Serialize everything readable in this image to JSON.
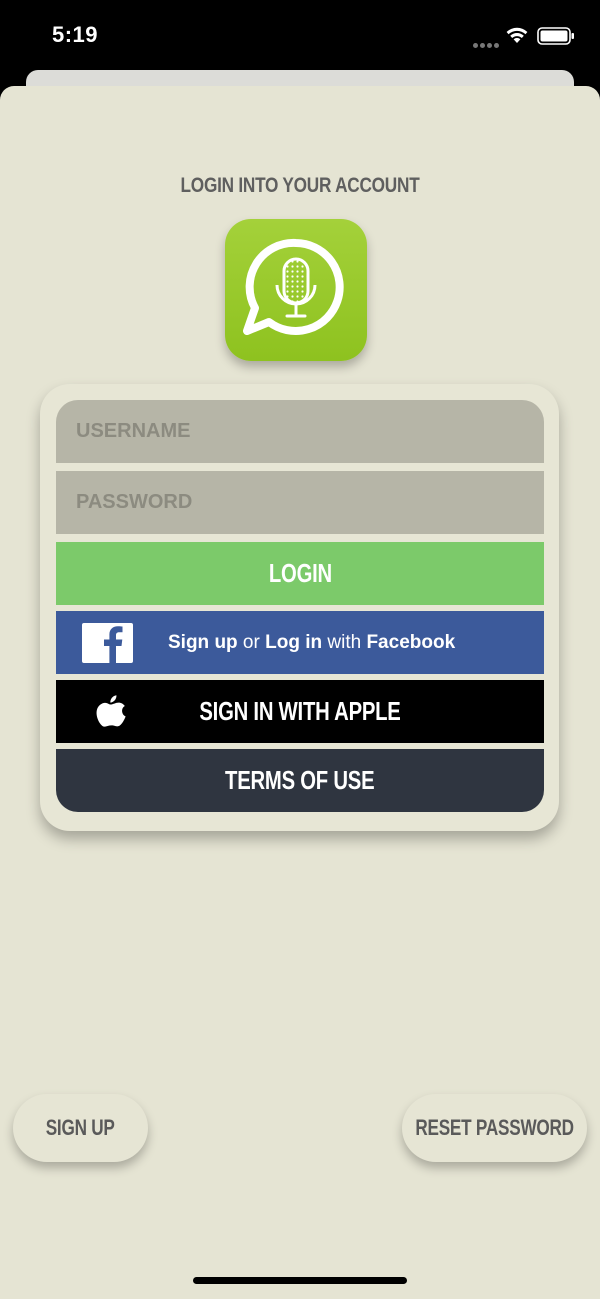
{
  "status_bar": {
    "time": "5:19"
  },
  "page": {
    "title": "LOGIN INTO YOUR ACCOUNT"
  },
  "login_form": {
    "username_placeholder": "USERNAME",
    "password_placeholder": "PASSWORD",
    "login_label": "LOGIN"
  },
  "facebook_button": {
    "part1": "Sign up",
    "part2": " or ",
    "part3": "Log in",
    "part4": " with ",
    "part5": "Facebook",
    "icon": "facebook-icon"
  },
  "apple_button": {
    "label": "SIGN IN WITH APPLE",
    "icon": "apple-icon"
  },
  "terms_button": {
    "label": "TERMS OF USE"
  },
  "footer": {
    "signup_label": "SIGN UP",
    "reset_label": "RESET PASSWORD"
  },
  "colors": {
    "background": "#e5e4d3",
    "login_green": "#7cca6a",
    "facebook_blue": "#3c5a9b",
    "apple_black": "#000000",
    "terms_dark": "#2f3540",
    "field_gray": "#b6b5a7",
    "logo_green": "#9bcb2e"
  }
}
